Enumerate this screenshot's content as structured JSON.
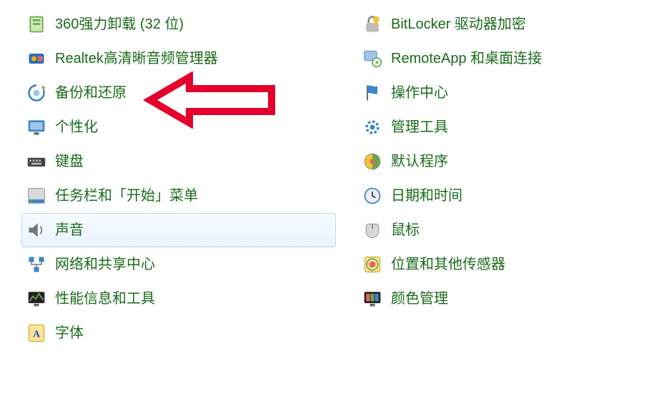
{
  "colors": {
    "link": "#1a6b1a",
    "arrow": "#e4002b",
    "selection_border": "#b9d7f4"
  },
  "selected_item_index": 7,
  "highlighted_item_index": 2,
  "left_column": [
    {
      "id": "uninstall-360",
      "label": "360强力卸载 (32 位)"
    },
    {
      "id": "realtek-audio",
      "label": "Realtek高清晰音频管理器"
    },
    {
      "id": "backup-restore",
      "label": "备份和还原"
    },
    {
      "id": "personalization",
      "label": "个性化"
    },
    {
      "id": "keyboard",
      "label": "键盘"
    },
    {
      "id": "taskbar-start",
      "label": "任务栏和「开始」菜单"
    },
    {
      "id": "sound",
      "label": "声音"
    },
    {
      "id": "network-sharing",
      "label": "网络和共享中心"
    },
    {
      "id": "performance-info",
      "label": "性能信息和工具"
    },
    {
      "id": "fonts",
      "label": "字体"
    }
  ],
  "right_column": [
    {
      "id": "bitlocker",
      "label": "BitLocker 驱动器加密"
    },
    {
      "id": "remoteapp",
      "label": "RemoteApp 和桌面连接"
    },
    {
      "id": "action-center",
      "label": "操作中心"
    },
    {
      "id": "admin-tools",
      "label": "管理工具"
    },
    {
      "id": "default-programs",
      "label": "默认程序"
    },
    {
      "id": "date-time",
      "label": "日期和时间"
    },
    {
      "id": "mouse",
      "label": "鼠标"
    },
    {
      "id": "location-sensors",
      "label": "位置和其他传感器"
    },
    {
      "id": "color-management",
      "label": "颜色管理"
    }
  ]
}
